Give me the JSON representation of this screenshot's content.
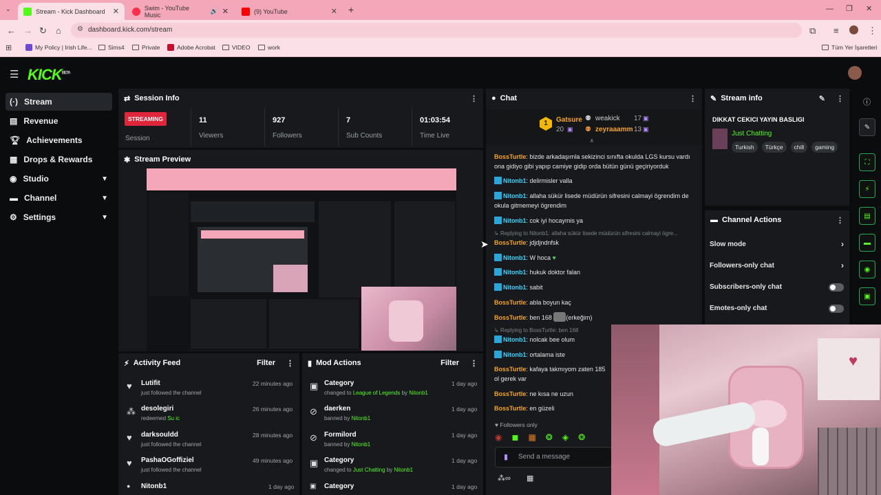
{
  "browser": {
    "tabs": [
      {
        "title": "Stream - Kick Dashboard",
        "active": true
      },
      {
        "title": "Swim - YouTube Music",
        "active": false
      },
      {
        "title": "(9) YouTube",
        "active": false
      }
    ],
    "url": "dashboard.kick.com/stream",
    "bookmarks": [
      "My Policy | Irish Life...",
      "Sims4",
      "Private",
      "Adobe Acrobat",
      "VIDEO",
      "work"
    ],
    "other_bookmarks": "Tüm Yer İşaretleri"
  },
  "app": {
    "logo": "KICK",
    "logo_badge": "BETA",
    "sidebar": [
      {
        "label": "Stream",
        "icon": "stream-icon"
      },
      {
        "label": "Revenue",
        "icon": "revenue-icon"
      },
      {
        "label": "Achievements",
        "icon": "trophy-icon"
      },
      {
        "label": "Drops & Rewards",
        "icon": "gift-icon"
      },
      {
        "label": "Studio",
        "icon": "studio-icon"
      },
      {
        "label": "Channel",
        "icon": "channel-icon"
      },
      {
        "label": "Settings",
        "icon": "gear-icon"
      }
    ],
    "session": {
      "title": "Session Info",
      "status": "STREAMING",
      "status_label": "Session",
      "stats": [
        {
          "value": "11",
          "label": "Viewers"
        },
        {
          "value": "927",
          "label": "Followers"
        },
        {
          "value": "7",
          "label": "Sub Counts"
        },
        {
          "value": "01:03:54",
          "label": "Time Live"
        }
      ]
    },
    "preview": {
      "title": "Stream Preview"
    },
    "activity": {
      "title": "Activity Feed",
      "filter": "Filter",
      "items": [
        {
          "name": "Lutifit",
          "sub": "just followed the channel",
          "time": "22 minutes ago"
        },
        {
          "name": "desolegiri",
          "sub": "redeemed",
          "extra": "Su ic",
          "time": "26 minutes ago"
        },
        {
          "name": "darksouldd",
          "sub": "just followed the channel",
          "time": "28 minutes ago"
        },
        {
          "name": "PashaOGoffiziel",
          "sub": "just followed the channel",
          "time": "49 minutes ago"
        },
        {
          "name": "Nitonb1",
          "sub": "",
          "time": "1 day ago"
        }
      ]
    },
    "mod": {
      "title": "Mod Actions",
      "filter": "Filter",
      "items": [
        {
          "name": "Category",
          "sub": "changed to",
          "a": "League of Legends",
          "by": "by",
          "b": "Nitonb1",
          "time": "1 day ago"
        },
        {
          "name": "daerken",
          "sub": "banned by",
          "a": "Nitonb1",
          "time": "1 day ago"
        },
        {
          "name": "Formilord",
          "sub": "banned by",
          "a": "Nitonb1",
          "time": "1 day ago"
        },
        {
          "name": "Category",
          "sub": "changed to",
          "a": "Just Chatting",
          "by": "by",
          "b": "Nitonb1",
          "time": "1 day ago"
        },
        {
          "name": "Category",
          "sub": "",
          "time": "1 day ago"
        }
      ]
    },
    "chat": {
      "title": "Chat",
      "leaders": [
        {
          "name": "Gatsure",
          "count": "20"
        },
        {
          "name": "weakick",
          "count": "17"
        },
        {
          "name": "zeyraaamm",
          "count": "13"
        }
      ],
      "rank": "1",
      "messages": [
        {
          "user": "BossTurtle",
          "text": "bizde arkadaşımla sekizinci sınıfta okulda LGS kursu vardı ona gidiyo gibi yapıp camiye gidip orda bütün günü geçiriyorduk"
        },
        {
          "user": "Nitonb1",
          "text": "delirmisler valla"
        },
        {
          "user": "Nitonb1",
          "text": "allaha sükür lisede müdürün sifresini calmayi ögrendim de okula gitmemeyi ögrendim"
        },
        {
          "user": "Nitonb1",
          "text": "cok iyi hocaymis ya"
        },
        {
          "user": "BossTurtle",
          "text": "jdjdjndnfsk"
        },
        {
          "user": "Nitonb1",
          "text": "W hoca"
        },
        {
          "user": "Nitonb1",
          "text": "hukuk doktor falan"
        },
        {
          "user": "Nitonb1",
          "text": "sabit"
        },
        {
          "user": "BossTurtle",
          "text": "abla boyun kaç"
        },
        {
          "user": "BossTurtle",
          "text": "ben 168"
        },
        {
          "user": "Nitonb1",
          "text": "nolcak bee olum"
        },
        {
          "user": "Nitonb1",
          "text": "ortalama iste"
        },
        {
          "user": "BossTurtle",
          "text": "kafaya takmıyom zaten 185 ol gerek var"
        },
        {
          "user": "BossTurtle",
          "text": "ne kısa ne uzun"
        },
        {
          "user": "BossTurtle",
          "text": "en güzeli"
        }
      ],
      "reply1": "Replying to Nitonb1: allaha sükür lisede müdürün sifresini calmayi ögre...",
      "reply2": "Replying to BossTurtle: ben 168",
      "emote_text": "(erkeğim)",
      "followers_only": "Followers only",
      "placeholder": "Send a message"
    },
    "stream_info": {
      "title": "Stream info",
      "stream_title": "DIKKAT CEKICI YAYIN BASLIGI",
      "category": "Just Chatting",
      "tags": [
        "Turkish",
        "Türkçe",
        "chill",
        "gaming"
      ]
    },
    "channel_actions": {
      "title": "Channel Actions",
      "items": [
        {
          "label": "Slow mode",
          "kind": "chevron"
        },
        {
          "label": "Followers-only chat",
          "kind": "chevron"
        },
        {
          "label": "Subscribers-only chat",
          "kind": "toggle"
        },
        {
          "label": "Emotes-only chat",
          "kind": "toggle"
        }
      ]
    }
  }
}
